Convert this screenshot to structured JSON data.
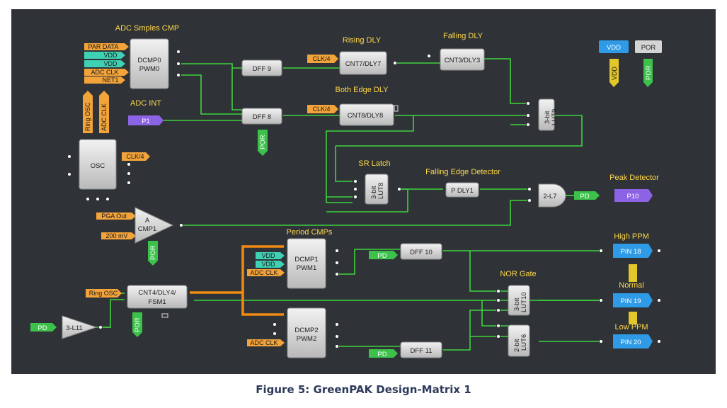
{
  "caption": "Figure 5: GreenPAK Design-Matrix 1",
  "colors": {
    "canvas": "#2f3337",
    "wire": "#3fd23f",
    "bus": "#f08a12",
    "title": "#ffd84a",
    "tag_orange": "#f2a33a",
    "tag_teal": "#3fd1b4",
    "tag_green": "#3cc24a",
    "tag_purple": "#8d63e6",
    "tag_blue": "#2f9ae6",
    "tag_yellow": "#e3c62a",
    "block": "#d4d4d4"
  },
  "titles": {
    "adc_cmp": "ADC Smples CMP",
    "rising": "Rising DLY",
    "falling": "Falling DLY",
    "both": "Both Edge DLY",
    "adc_int": "ADC INT",
    "sr": "SR Latch",
    "fed": "Falling Edge Detector",
    "peak": "Peak Detector",
    "period": "Period CMPs",
    "high": "High PPM",
    "nor": "NOR Gate",
    "normal": "Normal",
    "low": "Low PPM"
  },
  "blocks": {
    "dcmp0": [
      "DCMP0",
      "PWM0"
    ],
    "dff9": "DFF 9",
    "dff8": "DFF 8",
    "cnt7": "CNT7/DLY7",
    "cnt3": "CNT3/DLY3",
    "cnt8": "CNT8/DLY8",
    "lut9": [
      "3-bit",
      "LUT9"
    ],
    "osc": "OSC",
    "lut8": [
      "3-bit",
      "LUT8"
    ],
    "pdly1": "P DLY1",
    "and2": "2-L7",
    "acmp1": [
      "A",
      "CMP1"
    ],
    "dcmp1": [
      "DCMP1",
      "PWM1"
    ],
    "dcmp2": [
      "DCMP2",
      "PWM2"
    ],
    "cnt4": [
      "CNT4/DLY4/",
      "FSM1"
    ],
    "dff10": "DFF 10",
    "dff11": "DFF 11",
    "lut10": [
      "3-bit",
      "LUT10"
    ],
    "lut6": [
      "2-bit",
      "LUT6"
    ],
    "inv": "3-L11"
  },
  "tags": {
    "par_data": "PAR DATA",
    "vdd": "VDD",
    "adc_clk": "ADC CLK",
    "net1": "NET1",
    "p1": "P1",
    "ring_osc": "Ring OSC",
    "clk4": "CLK/4",
    "por": "POR",
    "pga_out": "PGA Out",
    "mv200": "200 mV",
    "pd": "PD",
    "p10": "P10",
    "pin18": "PIN 18",
    "pin19": "PIN 19",
    "pin20": "PIN 20"
  }
}
